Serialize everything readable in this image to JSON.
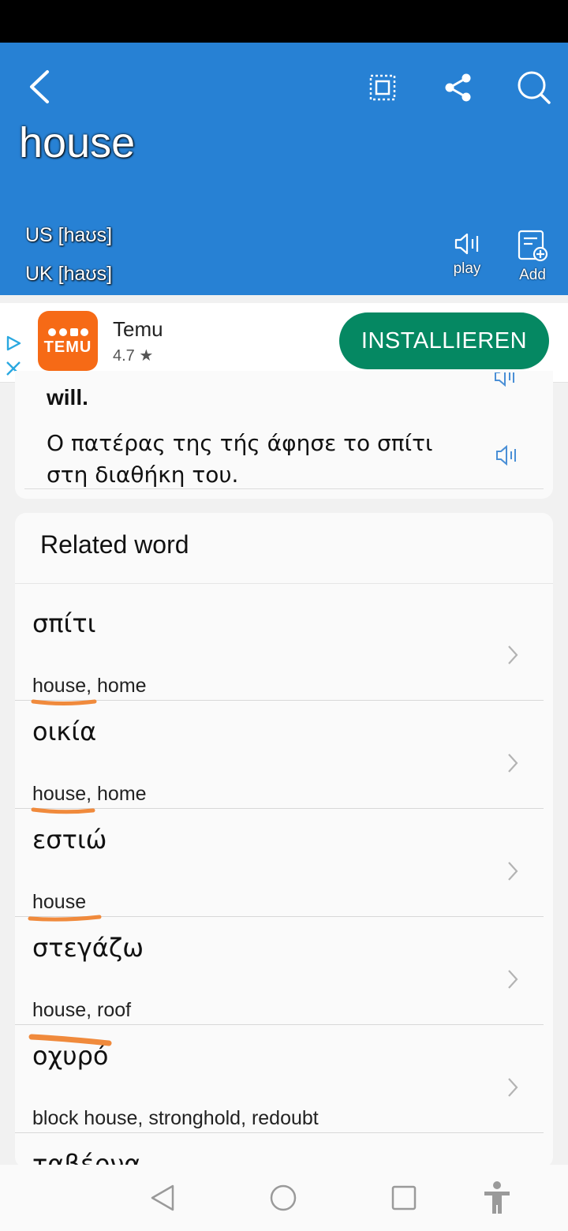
{
  "header": {
    "word": "house",
    "pronunciations": [
      "US [haʊs]",
      "UK [haʊs]"
    ],
    "play_label": "play",
    "add_label": "Add",
    "color": "#2781d4"
  },
  "ad": {
    "app_name": "Temu",
    "rating": "4.7 ★",
    "install_label": "INSTALLIEREN",
    "logo_text": "TEMU",
    "install_color": "#058862",
    "logo_color": "#f66a16"
  },
  "example": {
    "english_tail": "will.",
    "greek": "Ο πατέρας της τής άφησε το σπίτι στη διαθήκη του."
  },
  "related": {
    "title": "Related word",
    "items": [
      {
        "word": "σπίτι",
        "meaning": "house, home"
      },
      {
        "word": "οικία",
        "meaning": "house, home"
      },
      {
        "word": "εστιώ",
        "meaning": "house"
      },
      {
        "word": "στεγάζω",
        "meaning": "house, roof"
      },
      {
        "word": "οχυρό",
        "meaning": "block house, stronghold, redoubt"
      },
      {
        "word": "ταβέρνα",
        "meaning": ""
      }
    ]
  },
  "annotation_color": "#f08a3c"
}
